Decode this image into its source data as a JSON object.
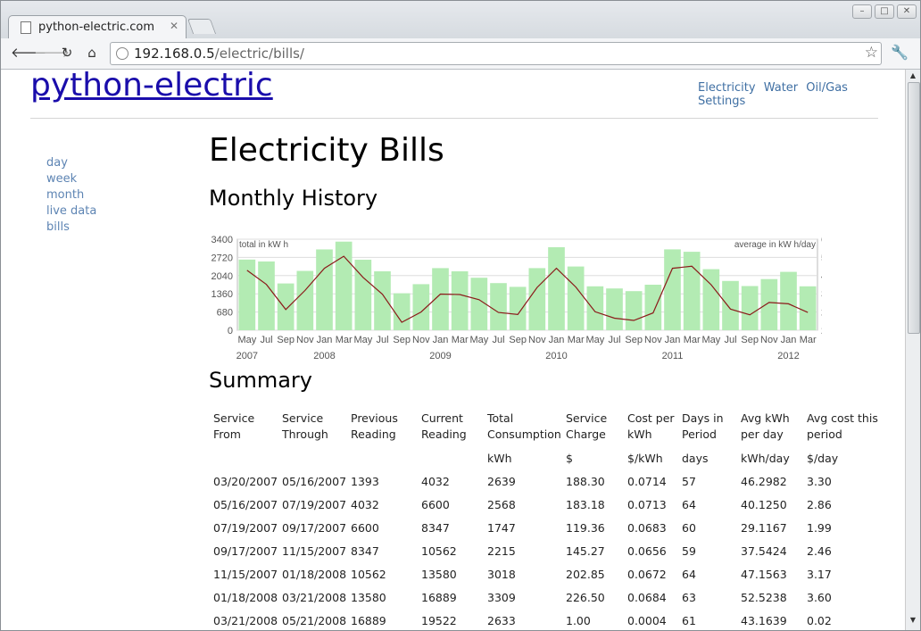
{
  "browser": {
    "tab_title": "python-electric.com",
    "url_host": "192.168.0.5",
    "url_path": "/electric/bills/"
  },
  "site": {
    "title": "python-electric",
    "topnav": [
      "Electricity",
      "Water",
      "Oil/Gas",
      "Settings"
    ],
    "sidenav": [
      "day",
      "week",
      "month",
      "live data",
      "bills"
    ]
  },
  "page": {
    "title": "Electricity Bills",
    "monthly_heading": "Monthly History",
    "summary_heading": "Summary"
  },
  "chart_data": {
    "type": "bar",
    "categories": [
      "May 2007",
      "Jul 2007",
      "Sep 2007",
      "Nov 2007",
      "Jan 2008",
      "Mar 2008",
      "May 2008",
      "Jul 2008",
      "Sep 2008",
      "Nov 2008",
      "Jan 2009",
      "Mar 2009",
      "May 2009",
      "Jul 2009",
      "Sep 2009",
      "Nov 2009",
      "Jan 2010",
      "Mar 2010",
      "May 2010",
      "Jul 2010",
      "Sep 2010",
      "Nov 2010",
      "Jan 2011",
      "Mar 2011",
      "May 2011",
      "Jul 2011",
      "Sep 2011",
      "Nov 2011",
      "Jan 2012",
      "Mar 2012"
    ],
    "tick_labels": [
      "May",
      "Jul",
      "Sep",
      "Nov",
      "Jan",
      "Mar",
      "May",
      "Jul",
      "Sep",
      "Nov",
      "Jan",
      "Mar",
      "May",
      "Jul",
      "Sep",
      "Nov",
      "Jan",
      "Mar",
      "May",
      "Jul",
      "Sep",
      "Nov",
      "Jan",
      "Mar",
      "May",
      "Jul",
      "Sep",
      "Nov",
      "Jan",
      "Mar"
    ],
    "year_labels": [
      "2007",
      "2008",
      "2009",
      "2010",
      "2011",
      "2012"
    ],
    "year_label_positions": [
      0,
      4,
      10,
      16,
      22,
      28
    ],
    "series": [
      {
        "name": "total in kW h",
        "type": "bar",
        "color": "#b3ebb3",
        "values": [
          2639,
          2568,
          1747,
          2215,
          3018,
          3309,
          2633,
          2200,
          1380,
          1720,
          2320,
          2200,
          1960,
          1760,
          1620,
          2320,
          3100,
          2380,
          1640,
          1560,
          1460,
          1700,
          3020,
          2930,
          2280,
          1840,
          1650,
          1910,
          2180,
          1640
        ]
      },
      {
        "name": "average in kW h/day",
        "type": "line",
        "color": "#8b1a1a",
        "values": [
          46.3,
          40.1,
          29.1,
          37.5,
          47.2,
          52.5,
          43.2,
          35.8,
          23.5,
          28.0,
          35.9,
          35.7,
          33.4,
          27.8,
          26.9,
          38.8,
          47.2,
          39.0,
          28.1,
          25.3,
          24.3,
          27.6,
          47.2,
          48.1,
          40.0,
          29.3,
          26.8,
          32.2,
          31.6,
          27.8
        ]
      }
    ],
    "left_axis": {
      "label": "total in kW h",
      "ticks": [
        0,
        680,
        1360,
        2040,
        2720,
        3400
      ],
      "range": [
        0,
        3400
      ]
    },
    "right_axis": {
      "label": "average in kW h/day",
      "ticks": [
        20,
        28,
        36,
        44,
        52,
        60
      ],
      "range": [
        20,
        60
      ]
    },
    "grid": true
  },
  "summary": {
    "headers": [
      {
        "line1": "Service",
        "line2": "From",
        "unit": ""
      },
      {
        "line1": "Service",
        "line2": "Through",
        "unit": ""
      },
      {
        "line1": "Previous",
        "line2": "Reading",
        "unit": ""
      },
      {
        "line1": "Current",
        "line2": "Reading",
        "unit": ""
      },
      {
        "line1": "Total",
        "line2": "Consumption",
        "unit": "kWh"
      },
      {
        "line1": "Service",
        "line2": "Charge",
        "unit": "$"
      },
      {
        "line1": "Cost per",
        "line2": "kWh",
        "unit": "$/kWh"
      },
      {
        "line1": "Days in",
        "line2": "Period",
        "unit": "days"
      },
      {
        "line1": "Avg kWh",
        "line2": "per day",
        "unit": "kWh/day"
      },
      {
        "line1": "Avg cost this",
        "line2": "period",
        "unit": "$/day"
      }
    ],
    "rows": [
      [
        "03/20/2007",
        "05/16/2007",
        "1393",
        "4032",
        "2639",
        "188.30",
        "0.0714",
        "57",
        "46.2982",
        "3.30"
      ],
      [
        "05/16/2007",
        "07/19/2007",
        "4032",
        "6600",
        "2568",
        "183.18",
        "0.0713",
        "64",
        "40.1250",
        "2.86"
      ],
      [
        "07/19/2007",
        "09/17/2007",
        "6600",
        "8347",
        "1747",
        "119.36",
        "0.0683",
        "60",
        "29.1167",
        "1.99"
      ],
      [
        "09/17/2007",
        "11/15/2007",
        "8347",
        "10562",
        "2215",
        "145.27",
        "0.0656",
        "59",
        "37.5424",
        "2.46"
      ],
      [
        "11/15/2007",
        "01/18/2008",
        "10562",
        "13580",
        "3018",
        "202.85",
        "0.0672",
        "64",
        "47.1563",
        "3.17"
      ],
      [
        "01/18/2008",
        "03/21/2008",
        "13580",
        "16889",
        "3309",
        "226.50",
        "0.0684",
        "63",
        "52.5238",
        "3.60"
      ],
      [
        "03/21/2008",
        "05/21/2008",
        "16889",
        "19522",
        "2633",
        "1.00",
        "0.0004",
        "61",
        "43.1639",
        "0.02"
      ]
    ]
  }
}
